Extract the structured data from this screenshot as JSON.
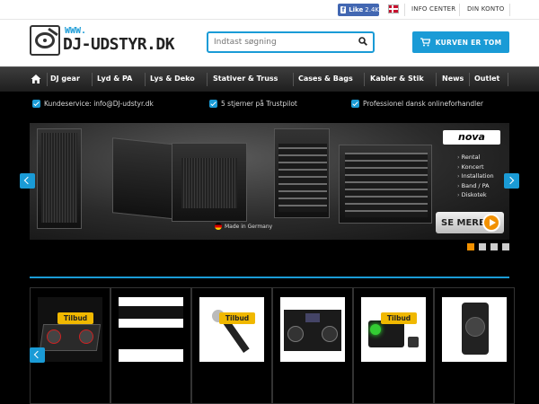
{
  "topbar": {
    "fb_like_label": "Like",
    "fb_like_count": "2.4K",
    "links": [
      "INFO CENTER",
      "DIN KONTO"
    ]
  },
  "header": {
    "logo_www": "WWW.",
    "logo_name": "DJ-UDSTYR.DK",
    "search_placeholder": "Indtast søgning",
    "cart_label": "KURVEN ER TOM"
  },
  "nav": {
    "items": [
      "DJ gear",
      "Lyd & PA",
      "Lys & Deko",
      "Stativer & Truss",
      "Cases & Bags",
      "Kabler & Stik",
      "News",
      "Outlet"
    ]
  },
  "usp": {
    "items": [
      "Kundeservice: info@DJ-udstyr.dk",
      "5 stjerner på Trustpilot",
      "Professionel dansk onlineforhandler"
    ]
  },
  "banner": {
    "brand": "nova",
    "features": [
      "Rental",
      "Koncert",
      "Installation",
      "Band / PA",
      "Diskotek"
    ],
    "made_in": "Made in Germany",
    "cta": "SE MERE",
    "speaker_badge": "nova",
    "slide_count": 4,
    "active_slide": 1
  },
  "products": {
    "badge_label": "Tilbud",
    "items": [
      {
        "tilbud": true
      },
      {
        "tilbud": false
      },
      {
        "tilbud": true
      },
      {
        "tilbud": false
      },
      {
        "tilbud": true
      },
      {
        "tilbud": false
      }
    ]
  },
  "colors": {
    "accent": "#1a9bd6",
    "badge": "#f0b800",
    "active_dot": "#f29100",
    "facebook": "#4267b2"
  }
}
